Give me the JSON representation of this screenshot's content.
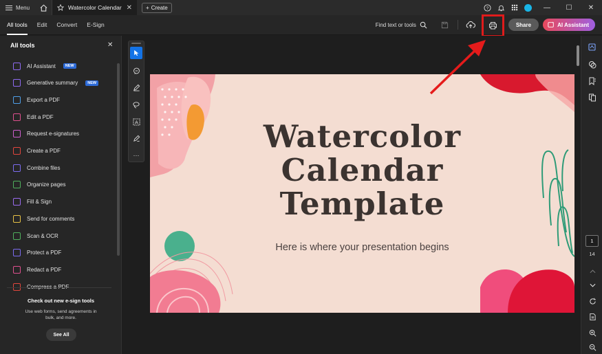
{
  "titlebar": {
    "menu_label": "Menu",
    "tab_title": "Watercolor Calendar Te...",
    "create_label": "Create"
  },
  "toolbar": {
    "tabs": [
      "All tools",
      "Edit",
      "Convert",
      "E-Sign"
    ],
    "find_label": "Find text or tools",
    "share_label": "Share",
    "ai_label": "AI Assistant"
  },
  "left_panel": {
    "heading": "All tools",
    "items": [
      {
        "label": "AI Assistant",
        "badge": "NEW",
        "color": "#8f6bf2"
      },
      {
        "label": "Generative summary",
        "badge": "NEW",
        "color": "#8f6bf2"
      },
      {
        "label": "Export a PDF",
        "badge": "",
        "color": "#4f9fe8"
      },
      {
        "label": "Edit a PDF",
        "badge": "",
        "color": "#e0508f"
      },
      {
        "label": "Request e-signatures",
        "badge": "",
        "color": "#cf5fce"
      },
      {
        "label": "Create a PDF",
        "badge": "",
        "color": "#e2463d"
      },
      {
        "label": "Combine files",
        "badge": "",
        "color": "#7c6cf0"
      },
      {
        "label": "Organize pages",
        "badge": "",
        "color": "#4fb05d"
      },
      {
        "label": "Fill & Sign",
        "badge": "",
        "color": "#9b6cf0"
      },
      {
        "label": "Send for comments",
        "badge": "",
        "color": "#e8c246"
      },
      {
        "label": "Scan & OCR",
        "badge": "",
        "color": "#4fb05d"
      },
      {
        "label": "Protect a PDF",
        "badge": "",
        "color": "#7c6cf0"
      },
      {
        "label": "Redact a PDF",
        "badge": "",
        "color": "#e0508f"
      },
      {
        "label": "Compress a PDF",
        "badge": "",
        "color": "#e2463d"
      }
    ],
    "promo_title": "Check out new e-sign tools",
    "promo_body": "Use web forms, send agreements in bulk, and more.",
    "see_all_label": "See All"
  },
  "slide": {
    "title_lines": [
      "Watercolor",
      "Calendar",
      "Template"
    ],
    "subtitle": "Here is where your presentation begins"
  },
  "page_nav": {
    "current_page": "1",
    "total_pages": "14"
  },
  "colors": {
    "accent_blue": "#1473e6",
    "highlight_red": "#e01b1b"
  }
}
